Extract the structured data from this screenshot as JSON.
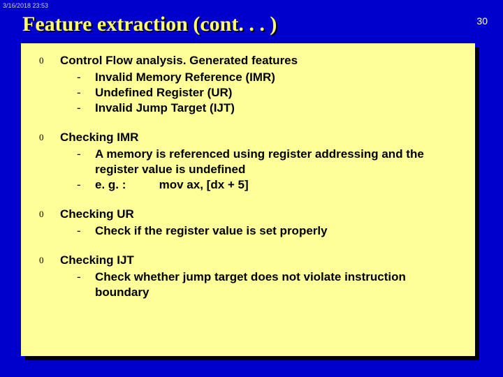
{
  "timestamp": "3/16/2018 23:53",
  "title": "Feature extraction (cont. . . )",
  "page_number": "30",
  "sections": [
    {
      "heading": "Control Flow analysis. Generated features",
      "items": [
        "Invalid Memory Reference (IMR)",
        "Undefined Register (UR)",
        "Invalid Jump Target (IJT)"
      ]
    },
    {
      "heading": "Checking IMR",
      "items": [
        "A memory is referenced using register addressing and the register value is undefined",
        "e. g. :          mov ax, [dx + 5]"
      ]
    },
    {
      "heading": "Checking UR",
      "items": [
        "Check if the register value is set properly"
      ]
    },
    {
      "heading": "Checking IJT",
      "items": [
        "Check whether jump target does not violate instruction boundary"
      ]
    }
  ]
}
